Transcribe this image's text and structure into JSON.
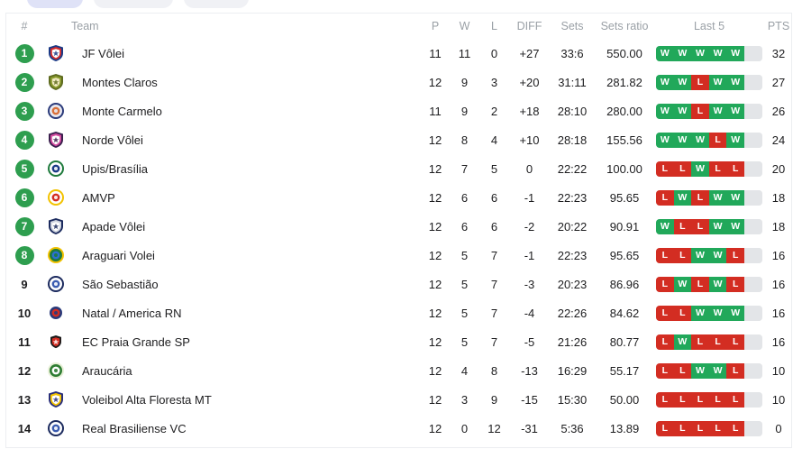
{
  "filters": [
    {
      "label": "",
      "active": true,
      "width": "w1"
    },
    {
      "label": "",
      "active": false,
      "width": "w2"
    },
    {
      "label": "",
      "active": false,
      "width": "w3"
    }
  ],
  "table": {
    "headers": {
      "rank": "#",
      "team": "Team",
      "p": "P",
      "w": "W",
      "l": "L",
      "diff": "DIFF",
      "sets": "Sets",
      "sets_ratio": "Sets ratio",
      "last5": "Last 5",
      "pts": "PTS"
    },
    "colors": {
      "win": "#21a85a",
      "loss": "#d32d22",
      "rank_badge": "#2e9e4f",
      "empty_slot": "#e3e5e8",
      "header_text": "#9aa0a6"
    },
    "rows": [
      {
        "rank": "1",
        "badge": true,
        "team": "JF Vôlei",
        "p": "11",
        "w": "11",
        "l": "0",
        "diff": "+27",
        "sets": "33:6",
        "ratio": "550.00",
        "last5": [
          "W",
          "W",
          "W",
          "W",
          "W"
        ],
        "pts": "32"
      },
      {
        "rank": "2",
        "badge": true,
        "team": "Montes Claros",
        "p": "12",
        "w": "9",
        "l": "3",
        "diff": "+20",
        "sets": "31:11",
        "ratio": "281.82",
        "last5": [
          "W",
          "W",
          "L",
          "W",
          "W"
        ],
        "pts": "27"
      },
      {
        "rank": "3",
        "badge": true,
        "team": "Monte Carmelo",
        "p": "11",
        "w": "9",
        "l": "2",
        "diff": "+18",
        "sets": "28:10",
        "ratio": "280.00",
        "last5": [
          "W",
          "W",
          "L",
          "W",
          "W"
        ],
        "pts": "26"
      },
      {
        "rank": "4",
        "badge": true,
        "team": "Norde Vôlei",
        "p": "12",
        "w": "8",
        "l": "4",
        "diff": "+10",
        "sets": "28:18",
        "ratio": "155.56",
        "last5": [
          "W",
          "W",
          "W",
          "L",
          "W"
        ],
        "pts": "24"
      },
      {
        "rank": "5",
        "badge": true,
        "team": "Upis/Brasília",
        "p": "12",
        "w": "7",
        "l": "5",
        "diff": "0",
        "sets": "22:22",
        "ratio": "100.00",
        "last5": [
          "L",
          "L",
          "W",
          "L",
          "L"
        ],
        "pts": "20"
      },
      {
        "rank": "6",
        "badge": true,
        "team": "AMVP",
        "p": "12",
        "w": "6",
        "l": "6",
        "diff": "-1",
        "sets": "22:23",
        "ratio": "95.65",
        "last5": [
          "L",
          "W",
          "L",
          "W",
          "W"
        ],
        "pts": "18"
      },
      {
        "rank": "7",
        "badge": true,
        "team": "Apade Vôlei",
        "p": "12",
        "w": "6",
        "l": "6",
        "diff": "-2",
        "sets": "20:22",
        "ratio": "90.91",
        "last5": [
          "W",
          "L",
          "L",
          "W",
          "W"
        ],
        "pts": "18"
      },
      {
        "rank": "8",
        "badge": true,
        "team": "Araguari Volei",
        "p": "12",
        "w": "5",
        "l": "7",
        "diff": "-1",
        "sets": "22:23",
        "ratio": "95.65",
        "last5": [
          "L",
          "L",
          "W",
          "W",
          "L"
        ],
        "pts": "16"
      },
      {
        "rank": "9",
        "badge": false,
        "team": "São Sebastião",
        "p": "12",
        "w": "5",
        "l": "7",
        "diff": "-3",
        "sets": "20:23",
        "ratio": "86.96",
        "last5": [
          "L",
          "W",
          "L",
          "W",
          "L"
        ],
        "pts": "16"
      },
      {
        "rank": "10",
        "badge": false,
        "team": "Natal / America RN",
        "p": "12",
        "w": "5",
        "l": "7",
        "diff": "-4",
        "sets": "22:26",
        "ratio": "84.62",
        "last5": [
          "L",
          "L",
          "W",
          "W",
          "W"
        ],
        "pts": "16"
      },
      {
        "rank": "11",
        "badge": false,
        "team": "EC Praia Grande SP",
        "p": "12",
        "w": "5",
        "l": "7",
        "diff": "-5",
        "sets": "21:26",
        "ratio": "80.77",
        "last5": [
          "L",
          "W",
          "L",
          "L",
          "L"
        ],
        "pts": "16"
      },
      {
        "rank": "12",
        "badge": false,
        "team": "Araucária",
        "p": "12",
        "w": "4",
        "l": "8",
        "diff": "-13",
        "sets": "16:29",
        "ratio": "55.17",
        "last5": [
          "L",
          "L",
          "W",
          "W",
          "L"
        ],
        "pts": "10"
      },
      {
        "rank": "13",
        "badge": false,
        "team": "Voleibol Alta Floresta MT",
        "p": "12",
        "w": "3",
        "l": "9",
        "diff": "-15",
        "sets": "15:30",
        "ratio": "50.00",
        "last5": [
          "L",
          "L",
          "L",
          "L",
          "L"
        ],
        "pts": "10"
      },
      {
        "rank": "14",
        "badge": false,
        "team": "Real Brasiliense VC",
        "p": "12",
        "w": "0",
        "l": "12",
        "diff": "-31",
        "sets": "5:36",
        "ratio": "13.89",
        "last5": [
          "L",
          "L",
          "L",
          "L",
          "L"
        ],
        "pts": "0"
      }
    ],
    "crests": [
      {
        "name": "jf-volei-crest",
        "shape": "shield",
        "c1": "#1b3a86",
        "c2": "#d42b2b",
        "c3": "#ffffff"
      },
      {
        "name": "montes-claros-crest",
        "shape": "shield",
        "c1": "#5e6b1f",
        "c2": "#8a9b2e",
        "c3": "#f0e9c0"
      },
      {
        "name": "monte-carmelo-crest",
        "shape": "circle",
        "c1": "#2a3a7a",
        "c2": "#e8eaf2",
        "c3": "#d9703a"
      },
      {
        "name": "norde-volei-crest",
        "shape": "shield",
        "c1": "#3b1f4e",
        "c2": "#d44ba0",
        "c3": "#ffffff"
      },
      {
        "name": "upis-brasilia-crest",
        "shape": "circle",
        "c1": "#1e7a3c",
        "c2": "#ffffff",
        "c3": "#1b3a86"
      },
      {
        "name": "amvp-crest",
        "shape": "circle",
        "c1": "#f2c200",
        "c2": "#ffffff",
        "c3": "#d32d22"
      },
      {
        "name": "apade-volei-crest",
        "shape": "shield",
        "c1": "#1b2a5e",
        "c2": "#cfd4df",
        "c3": "#ffffff"
      },
      {
        "name": "araguari-volei-crest",
        "shape": "circle",
        "c1": "#f2c200",
        "c2": "#1e7a3c",
        "c3": "#2a6fd4"
      },
      {
        "name": "sao-sebastiao-crest",
        "shape": "circle",
        "c1": "#1b2a5e",
        "c2": "#ffffff",
        "c3": "#3a5bb0"
      },
      {
        "name": "natal-america-rn-crest",
        "shape": "circle",
        "c1": "#ffffff",
        "c2": "#2a3a7a",
        "c3": "#d32d22"
      },
      {
        "name": "ec-praia-grande-sp-crest",
        "shape": "shield",
        "c1": "#ffffff",
        "c2": "#1a1a1a",
        "c3": "#d32d22"
      },
      {
        "name": "araucaria-crest",
        "shape": "circle",
        "c1": "#e8f0d8",
        "c2": "#2e7d32",
        "c3": "#ffffff"
      },
      {
        "name": "voleibol-alta-floresta-crest",
        "shape": "shield",
        "c1": "#2a2f7a",
        "c2": "#f2c200",
        "c3": "#ffffff"
      },
      {
        "name": "real-brasiliense-vc-crest",
        "shape": "circle",
        "c1": "#1b2a5e",
        "c2": "#ffffff",
        "c3": "#3a5bb0"
      }
    ]
  }
}
